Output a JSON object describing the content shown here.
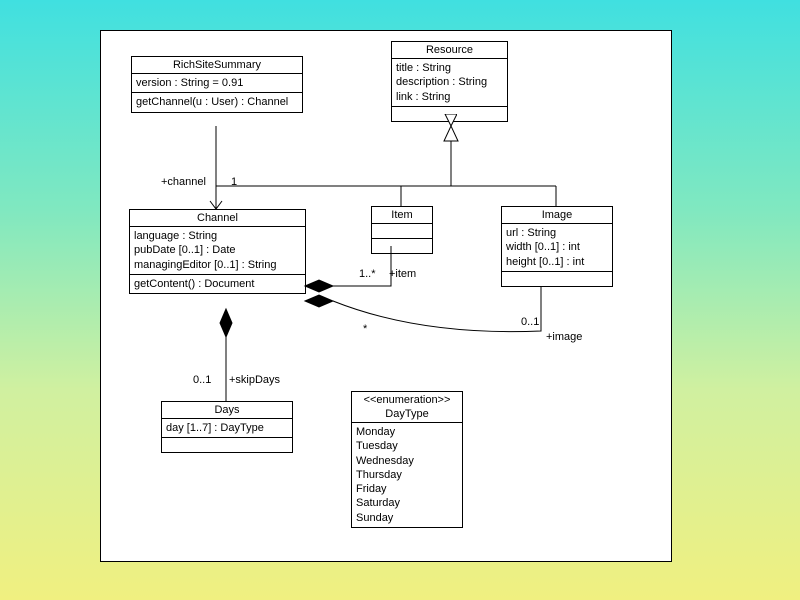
{
  "classes": {
    "rss": {
      "name": "RichSiteSummary",
      "attrs": [
        "version : String = 0.91"
      ],
      "ops": [
        "getChannel(u : User) : Channel"
      ]
    },
    "resource": {
      "name": "Resource",
      "attrs": [
        "title : String",
        "description : String",
        "link : String"
      ]
    },
    "channel": {
      "name": "Channel",
      "attrs": [
        "language : String",
        "pubDate [0..1] : Date",
        "managingEditor [0..1] : String"
      ],
      "ops": [
        "getContent() : Document"
      ]
    },
    "item": {
      "name": "Item"
    },
    "image": {
      "name": "Image",
      "attrs": [
        "url : String",
        "width [0..1] : int",
        "height [0..1] : int"
      ]
    },
    "days": {
      "name": "Days",
      "attrs": [
        "day [1..7] : DayType"
      ]
    },
    "daytype": {
      "stereo": "<<enumeration>>",
      "name": "DayType",
      "literals": [
        "Monday",
        "Tuesday",
        "Wednesday",
        "Thursday",
        "Friday",
        "Saturday",
        "Sunday"
      ]
    }
  },
  "labels": {
    "channelRole": "+channel",
    "channelMult": "1",
    "itemMult": "1..*",
    "itemRole": "+item",
    "imageStar": "*",
    "imageMult": "0..1",
    "imageRole": "+image",
    "skipMult": "0..1",
    "skipRole": "+skipDays"
  }
}
